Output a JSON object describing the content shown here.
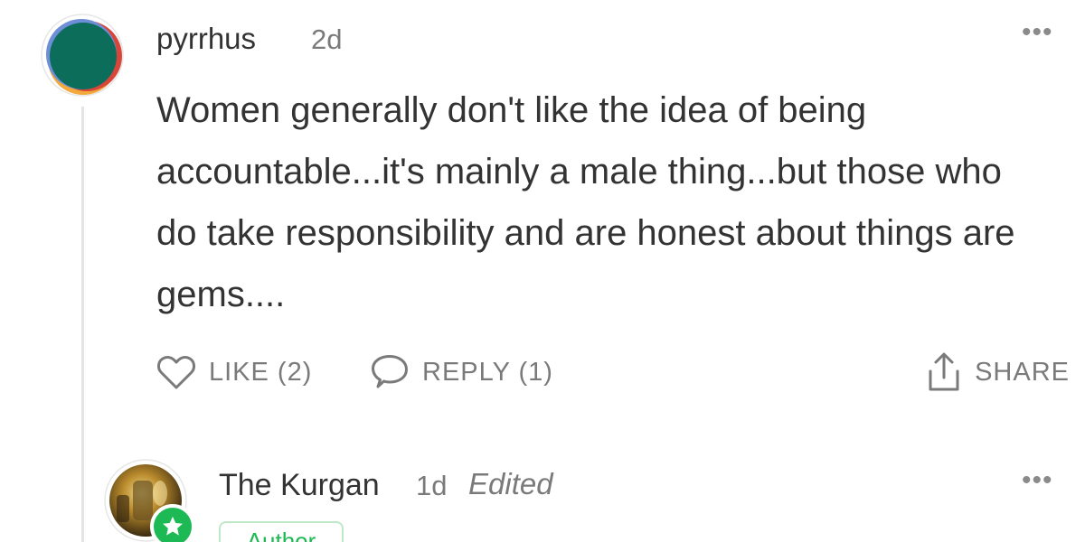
{
  "comment": {
    "author": "pyrrhus",
    "time": "2d",
    "text": "Women generally don't like the idea of being accountable...it's mainly a male thing...but those who do take responsibility and are honest about things are gems....",
    "more_label": "•••",
    "actions": {
      "like_label": "LIKE (2)",
      "reply_label": "REPLY (1)",
      "share_label": "SHARE"
    }
  },
  "reply": {
    "author": "The Kurgan",
    "time": "1d",
    "edited_label": "Edited",
    "role_label": "Author",
    "more_label": "•••"
  },
  "icons": {
    "like": "heart-icon",
    "reply": "speech-bubble-icon",
    "share": "share-icon",
    "more": "more-dots-icon",
    "badge": "star-icon"
  },
  "colors": {
    "text": "#333333",
    "muted": "#7a7a7a",
    "accent": "#1db954",
    "thread_line": "#e4e4e4"
  }
}
